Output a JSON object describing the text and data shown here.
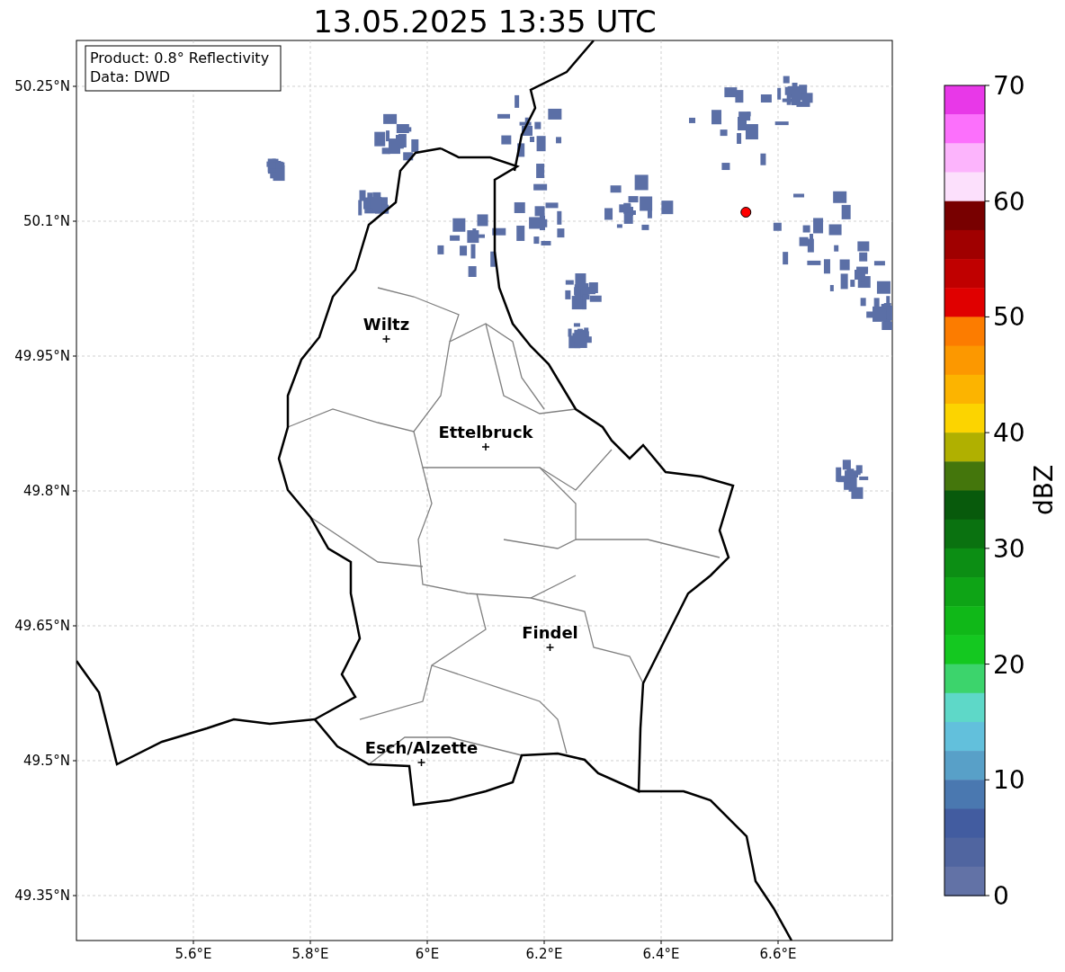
{
  "title": "13.05.2025 13:35 UTC",
  "info_box": {
    "lines": [
      "Product: 0.8° Reflectivity",
      "Data: DWD"
    ]
  },
  "x_ticks": [
    "5.6°E",
    "5.8°E",
    "6°E",
    "6.2°E",
    "6.4°E",
    "6.6°E"
  ],
  "y_ticks": [
    "50.25°N",
    "50.1°N",
    "49.95°N",
    "49.8°N",
    "49.65°N",
    "49.5°N",
    "49.35°N"
  ],
  "cities": [
    {
      "name": "Wiltz"
    },
    {
      "name": "Ettelbruck"
    },
    {
      "name": "Findel"
    },
    {
      "name": "Esch/Alzette"
    }
  ],
  "colorbar": {
    "label": "dBZ",
    "ticks": [
      "70",
      "60",
      "50",
      "40",
      "30",
      "20",
      "10",
      "0"
    ],
    "bins": [
      {
        "color": "#e838e8"
      },
      {
        "color": "#fc70fc"
      },
      {
        "color": "#fcb4fc"
      },
      {
        "color": "#fce0fc"
      },
      {
        "color": "#780000"
      },
      {
        "color": "#a00000"
      },
      {
        "color": "#c00000"
      },
      {
        "color": "#e00000"
      },
      {
        "color": "#fc7c00"
      },
      {
        "color": "#fc9800"
      },
      {
        "color": "#fcb400"
      },
      {
        "color": "#fcd400"
      },
      {
        "color": "#b0b000"
      },
      {
        "color": "#44760c"
      },
      {
        "color": "#085a0c"
      },
      {
        "color": "#0a7210"
      },
      {
        "color": "#0c8e14"
      },
      {
        "color": "#0ea416"
      },
      {
        "color": "#10b818"
      },
      {
        "color": "#14c820"
      },
      {
        "color": "#3cd46c"
      },
      {
        "color": "#5ed8c8"
      },
      {
        "color": "#62c0dc"
      },
      {
        "color": "#58a0c8"
      },
      {
        "color": "#4a78b0"
      },
      {
        "color": "#425ca0"
      },
      {
        "color": "#5065a0"
      },
      {
        "color": "#6272a6"
      }
    ]
  }
}
